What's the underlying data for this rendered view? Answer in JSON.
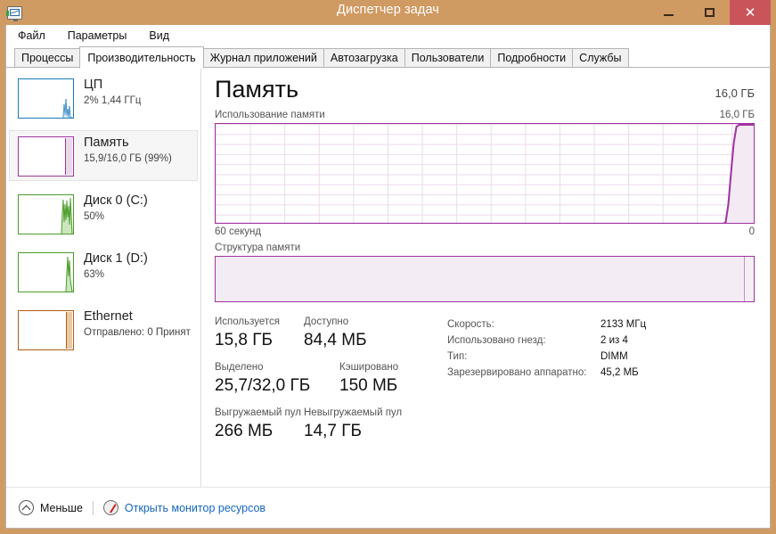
{
  "window": {
    "title": "Диспетчер задач",
    "icon": "task-manager-icon",
    "minimize": "—",
    "maximize": "□",
    "close": "✕",
    "titlebar_color": "#d09a63",
    "close_color": "#c9555a"
  },
  "menu": {
    "items": [
      {
        "label": "Файл"
      },
      {
        "label": "Параметры"
      },
      {
        "label": "Вид"
      }
    ]
  },
  "tabs": [
    {
      "label": "Процессы",
      "active": false
    },
    {
      "label": "Производительность",
      "active": true
    },
    {
      "label": "Журнал приложений",
      "active": false
    },
    {
      "label": "Автозагрузка",
      "active": false
    },
    {
      "label": "Пользователи",
      "active": false
    },
    {
      "label": "Подробности",
      "active": false
    },
    {
      "label": "Службы",
      "active": false
    }
  ],
  "sidebar": {
    "items": [
      {
        "name": "cpu",
        "title": "ЦП",
        "subtitle": "2% 1,44 ГГц",
        "color": "#1a7bb9",
        "selected": false
      },
      {
        "name": "memory",
        "title": "Память",
        "subtitle": "15,9/16,0 ГБ (99%)",
        "color": "#a033a0",
        "selected": true
      },
      {
        "name": "disk-0",
        "title": "Диск 0 (C:)",
        "subtitle": "50%",
        "color": "#4a9b28",
        "selected": false
      },
      {
        "name": "disk-1",
        "title": "Диск 1 (D:)",
        "subtitle": "63%",
        "color": "#4a9b28",
        "selected": false
      },
      {
        "name": "ethernet",
        "title": "Ethernet",
        "subtitle": "Отправлено: 0 Принят",
        "color": "#b45c10",
        "selected": false
      }
    ]
  },
  "main": {
    "title": "Память",
    "total": "16,0 ГБ",
    "usage_graph": {
      "caption": "Использование памяти",
      "max_label": "16,0 ГБ",
      "axis_left": "60 секунд",
      "axis_right": "0",
      "line_color": "#a033a0",
      "fill_color": "#f3eaf3"
    },
    "composition": {
      "caption": "Структура памяти",
      "border_color": "#a033a0"
    },
    "stats": [
      [
        {
          "caption": "Используется",
          "value": "15,8 ГБ"
        },
        {
          "caption": "Доступно",
          "value": "84,4 МБ"
        }
      ],
      [
        {
          "caption": "Выделено",
          "value": "25,7/32,0 ГБ"
        },
        {
          "caption": "Кэшировано",
          "value": "150 МБ"
        }
      ],
      [
        {
          "caption": "Выгружаемый пул",
          "value": "266 МБ"
        },
        {
          "caption": "Невыгружаемый пул",
          "value": "14,7 ГБ"
        }
      ]
    ],
    "specs": [
      {
        "key": "Скорость:",
        "value": "2133 МГц"
      },
      {
        "key": "Использовано гнезд:",
        "value": "2 из 4"
      },
      {
        "key": "Тип:",
        "value": "DIMM"
      },
      {
        "key": "Зарезервировано аппаратно:",
        "value": "45,2 МБ"
      }
    ]
  },
  "footer": {
    "collapse_label": "Меньше",
    "collapse_icon": "chevron-up-circle-icon",
    "resmon_label": "Открыть монитор ресурсов",
    "resmon_icon": "resource-monitor-icon",
    "link_color": "#1566c0"
  },
  "chart_data": {
    "type": "area",
    "title": "Использование памяти",
    "xlabel": "60 секунд",
    "ylabel": "16,0 ГБ",
    "ylim": [
      0,
      16.0
    ],
    "xlim": [
      60,
      0
    ],
    "grid": true,
    "series": [
      {
        "name": "Использование памяти (ГБ)",
        "x": [
          60,
          10,
          8,
          7.5,
          7,
          0
        ],
        "values": [
          0,
          0,
          0.2,
          8.0,
          15.9,
          15.9
        ]
      }
    ]
  }
}
